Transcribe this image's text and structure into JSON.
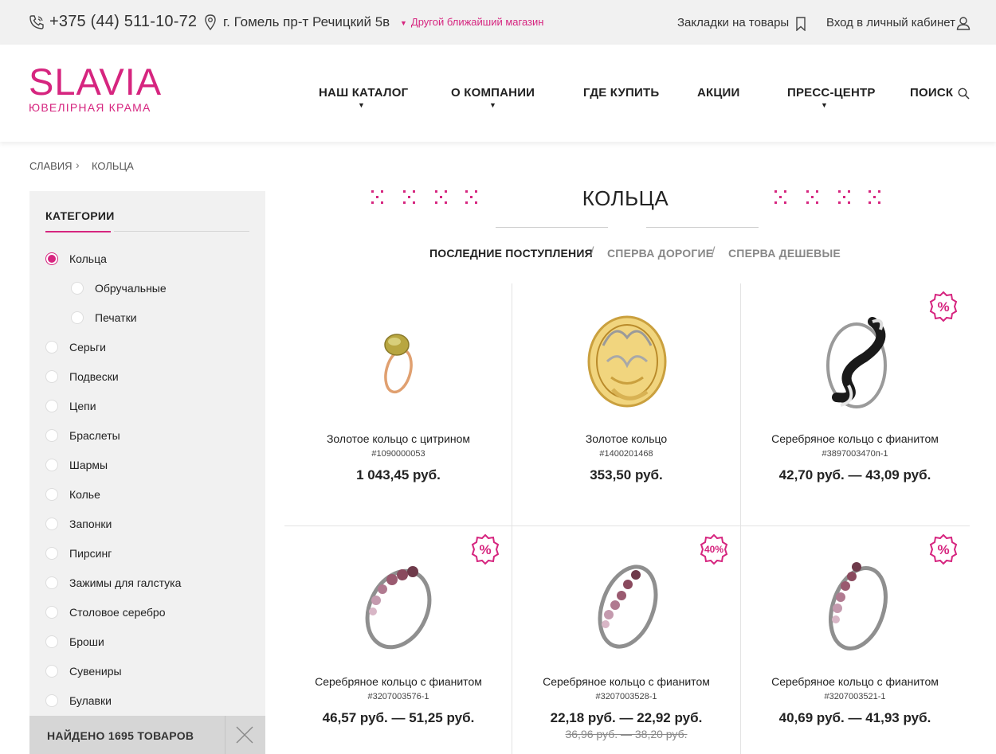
{
  "topbar": {
    "phone": "+375 (44) 511-10-72",
    "address": "г. Гомель пр-т Речицкий 5в",
    "other_store": "Другой ближайший магазин",
    "bookmarks": "Закладки на товары",
    "login": "Вход в личный кабинет"
  },
  "logo": {
    "name": "SLAVIA",
    "subtitle": "ЮВЕЛІРНАЯ КРАМА"
  },
  "nav": {
    "catalog": "НАШ КАТАЛОГ",
    "about": "О КОМПАНИИ",
    "where": "ГДЕ КУПИТЬ",
    "promo": "АКЦИИ",
    "press": "ПРЕСС-ЦЕНТР",
    "search": "ПОИСК"
  },
  "breadcrumb": {
    "home": "СЛАВИЯ",
    "current": "КОЛЬЦА"
  },
  "sidebar": {
    "title": "КАТЕГОРИИ",
    "categories": [
      "Кольца",
      "Обручальные",
      "Печатки",
      "Серьги",
      "Подвески",
      "Цепи",
      "Браслеты",
      "Шармы",
      "Колье",
      "Запонки",
      "Пирсинг",
      "Зажимы для галстука",
      "Столовое серебро",
      "Броши",
      "Сувениры",
      "Булавки"
    ],
    "selected": "Кольца",
    "found": "НАЙДЕНО 1695 ТОВАРОВ"
  },
  "page": {
    "title": "КОЛЬЦА",
    "sort": {
      "latest": "ПОСЛЕДНИЕ ПОСТУПЛЕНИЯ",
      "expensive": "СПЕРВА ДОРОГИЕ",
      "cheap": "СПЕРВА ДЕШЕВЫЕ",
      "separator": "/"
    }
  },
  "products": [
    {
      "name": "Золотое кольцо с цитрином",
      "sku": "#1090000053",
      "price": "1 043,45 руб.",
      "badge": ""
    },
    {
      "name": "Золотое кольцо",
      "sku": "#1400201468",
      "price": "353,50 руб.",
      "badge": ""
    },
    {
      "name": "Серебряное кольцо с фианитом",
      "sku": "#3897003470п-1",
      "price": "42,70 руб. — 43,09 руб.",
      "badge": "%"
    },
    {
      "name": "Серебряное кольцо с фианитом",
      "sku": "#3207003576-1",
      "price": "46,57 руб. — 51,25 руб.",
      "badge": "%"
    },
    {
      "name": "Серебряное кольцо с фианитом",
      "sku": "#3207003528-1",
      "price": "22,18 руб. — 22,92 руб.",
      "old_price": "36,96 руб. — 38,20 руб.",
      "badge": "40%"
    },
    {
      "name": "Серебряное кольцо с фианитом",
      "sku": "#3207003521-1",
      "price": "40,69 руб. — 41,93 руб.",
      "badge": "%"
    }
  ],
  "colors": {
    "accent": "#d6257f",
    "topbar_bg": "#f1f1f1",
    "sidebar_bg": "#f1f1f1"
  },
  "icons": [
    "phone-icon",
    "map-pin-icon",
    "bookmark-icon",
    "user-icon",
    "search-icon",
    "close-icon",
    "discount-badge-icon"
  ]
}
